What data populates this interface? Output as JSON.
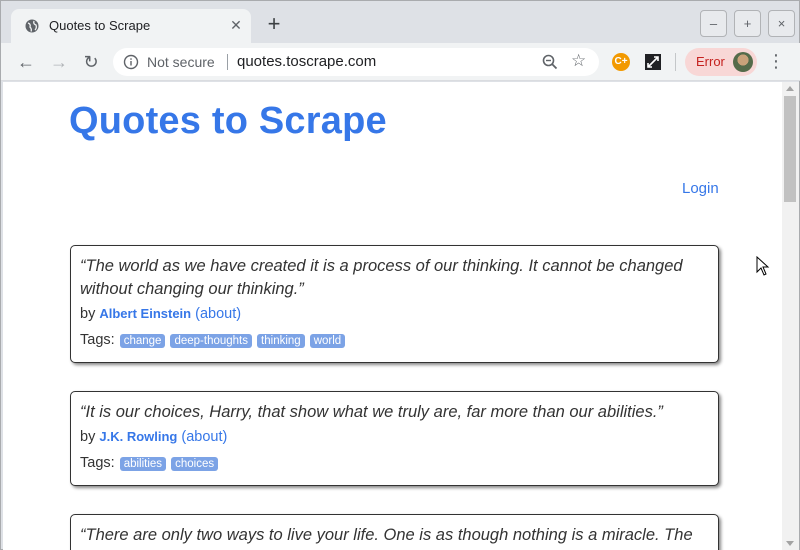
{
  "browser": {
    "tab_title": "Quotes to Scrape",
    "new_tab": "+",
    "security_label": "Not secure",
    "url": "quotes.toscrape.com",
    "profile_status": "Error",
    "extension_label": "C+",
    "window_controls": [
      "–",
      "+",
      "×"
    ]
  },
  "page": {
    "site_title": "Quotes to Scrape",
    "login_label": "Login",
    "by_label": "by",
    "about_label": "(about)",
    "tags_label": "Tags:",
    "quotes": [
      {
        "text": "“The world as we have created it is a process of our thinking. It cannot be changed without changing our thinking.”",
        "author": "Albert Einstein",
        "tags": [
          "change",
          "deep-thoughts",
          "thinking",
          "world"
        ]
      },
      {
        "text": "“It is our choices, Harry, that show what we truly are, far more than our abilities.”",
        "author": "J.K. Rowling",
        "tags": [
          "abilities",
          "choices"
        ]
      },
      {
        "text": "“There are only two ways to live your life. One is as though nothing is a miracle. The",
        "author": "",
        "tags": []
      }
    ]
  },
  "colors": {
    "link": "#3677e8",
    "tag_bg": "#7ca3e6",
    "error_badge": "#f8d7d6"
  }
}
